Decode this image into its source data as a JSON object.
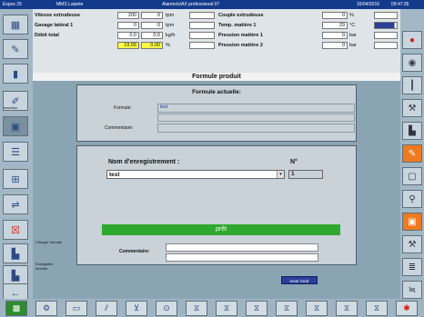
{
  "titlebar": {
    "left": "Expos 25",
    "user": "MMS Laiante",
    "product": "Alarmo/s/AX professional 07",
    "date": "16/04/2016",
    "time": "09:47:35"
  },
  "params": {
    "left": [
      {
        "label": "Vitesse extrudeuse",
        "setpoint": "200",
        "actual": "0",
        "unit": "tpm"
      },
      {
        "label": "Gavage latéral 1",
        "setpoint": "0",
        "actual": "0",
        "unit": "tpm"
      },
      {
        "label": "Débit total",
        "setpoint": "0,0",
        "actual": "0,0",
        "unit": "kg/h"
      },
      {
        "label": "",
        "setpoint": "19,05",
        "actual": "0,00",
        "unit": "%"
      }
    ],
    "right": [
      {
        "label": "Couple extrudeuse",
        "actual": "0",
        "unit": "%"
      },
      {
        "label": "Temp. matière 1",
        "actual": "29",
        "unit": "°C"
      },
      {
        "label": "Pression matière 1",
        "actual": "0",
        "unit": "bar"
      },
      {
        "label": "Pression matière 2",
        "actual": "0",
        "unit": "bar"
      }
    ],
    "highlight_color": "#ffff44"
  },
  "main": {
    "title": "Formule produit",
    "current": {
      "heading": "Formule actuelle:",
      "formula_label": "Formule:",
      "formula_value": "test",
      "comment_label": "Commentaire:"
    },
    "save": {
      "name_label": "Nom d'enregistrement :",
      "number_label": "N°",
      "name_value": "test",
      "number_value": "1",
      "status": "prêt",
      "status_color": "#2ea82e",
      "comment_label": "Commentaire:",
      "reset_button": "reset l'ordr"
    }
  },
  "left_buttons": [
    {
      "icon": "grid-icon",
      "glyph": "▦",
      "label": ""
    },
    {
      "icon": "brush-icon",
      "glyph": "✎",
      "label": ""
    },
    {
      "icon": "bars-icon",
      "glyph": "▮",
      "label": ""
    },
    {
      "icon": "pencil-icon",
      "glyph": "✐",
      "label": "Insertion"
    },
    {
      "icon": "machine-icon",
      "glyph": "▣",
      "label": ""
    },
    {
      "icon": "list-icon",
      "glyph": "☰",
      "label": ""
    },
    {
      "icon": "ruler-icon",
      "glyph": "⊞",
      "label": ""
    },
    {
      "icon": "screw-icon",
      "glyph": "⇌",
      "label": ""
    },
    {
      "icon": "delete-icon",
      "glyph": "☒",
      "label": ""
    },
    {
      "icon": "load-formula-icon",
      "glyph": "▙",
      "label": "Charger formule"
    },
    {
      "icon": "save-formula-icon",
      "glyph": "▙",
      "label": "Enregistrer formule"
    },
    {
      "icon": "back-arrow-icon",
      "glyph": "←",
      "label": ""
    }
  ],
  "right_buttons": [
    {
      "icon": "stop-icon",
      "glyph": "●"
    },
    {
      "icon": "eye-icon",
      "glyph": "◉"
    },
    {
      "icon": "thermo-icon",
      "glyph": "┃"
    },
    {
      "icon": "tool-icon",
      "glyph": "⚒"
    },
    {
      "icon": "chart-icon",
      "glyph": "▙"
    },
    {
      "icon": "edit-icon",
      "glyph": "✎"
    },
    {
      "icon": "frame-icon",
      "glyph": "▢"
    },
    {
      "icon": "wrench-icon",
      "glyph": "⚲"
    },
    {
      "icon": "disk-icon",
      "glyph": "▣"
    },
    {
      "icon": "hammer-icon",
      "glyph": "⚒"
    },
    {
      "icon": "graph-icon",
      "glyph": "≣"
    },
    {
      "icon": "trend-icon",
      "glyph": "≒"
    }
  ],
  "bottom_buttons": [
    {
      "icon": "home-icon",
      "glyph": "▩"
    },
    {
      "icon": "settings-icon",
      "glyph": "⚙"
    },
    {
      "icon": "counter-icon",
      "glyph": "▭"
    },
    {
      "icon": "extruder-icon",
      "glyph": "⫽"
    },
    {
      "icon": "dosing-icon",
      "glyph": "⊻"
    },
    {
      "icon": "filter-icon",
      "glyph": "⊙"
    },
    {
      "icon": "hopper1-icon",
      "glyph": "⧖"
    },
    {
      "icon": "hopper2-icon",
      "glyph": "⧖"
    },
    {
      "icon": "hopper3-icon",
      "glyph": "⧖"
    },
    {
      "icon": "hopper4-icon",
      "glyph": "⧖"
    },
    {
      "icon": "hopper5-icon",
      "glyph": "⧖"
    },
    {
      "icon": "hopper6-icon",
      "glyph": "⧖"
    },
    {
      "icon": "hopper7-icon",
      "glyph": "⧖"
    },
    {
      "icon": "alarm-icon",
      "glyph": "✱"
    }
  ]
}
